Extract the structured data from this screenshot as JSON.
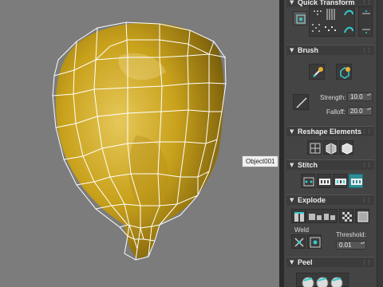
{
  "viewport": {
    "object_label": "Object001",
    "background_color": "#7c7c7c",
    "mesh_color": "#ffffff",
    "object_color": "#c9a31a"
  },
  "panel": {
    "quick_transform": {
      "title": "Quick Transform"
    },
    "brush": {
      "title": "Brush",
      "strength_label": "Strength:",
      "strength_value": "10.0",
      "falloff_label": "Falloff:",
      "falloff_value": "20.0"
    },
    "reshape": {
      "title": "Reshape Elements"
    },
    "stitch": {
      "title": "Stitch"
    },
    "explode": {
      "title": "Explode",
      "weld_label": "Weld",
      "threshold_label": "Threshold:",
      "threshold_value": "0.01"
    },
    "peel": {
      "title": "Peel"
    },
    "accent_color": "#2f8f96"
  }
}
